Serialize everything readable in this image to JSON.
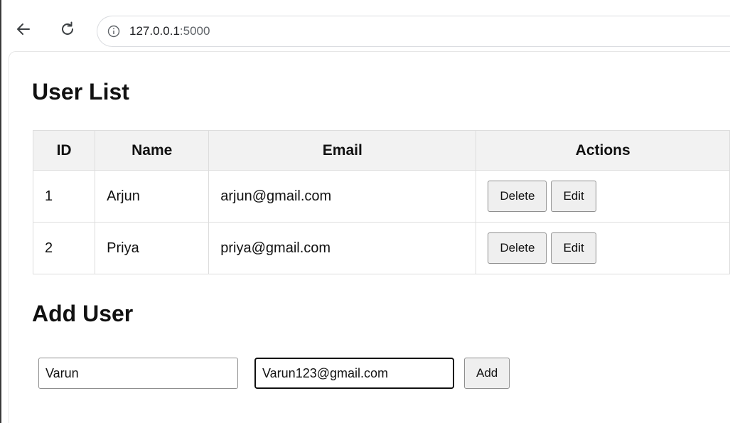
{
  "browser": {
    "url_host": "127.0.0.1",
    "url_port": ":5000"
  },
  "user_list": {
    "title": "User List",
    "columns": [
      "ID",
      "Name",
      "Email",
      "Actions"
    ],
    "rows": [
      {
        "id": "1",
        "name": "Arjun",
        "email": "arjun@gmail.com",
        "delete_label": "Delete",
        "edit_label": "Edit"
      },
      {
        "id": "2",
        "name": "Priya",
        "email": "priya@gmail.com",
        "delete_label": "Delete",
        "edit_label": "Edit"
      }
    ]
  },
  "add_user": {
    "title": "Add User",
    "name_value": "Varun",
    "email_value": "Varun123@gmail.com",
    "add_label": "Add"
  }
}
